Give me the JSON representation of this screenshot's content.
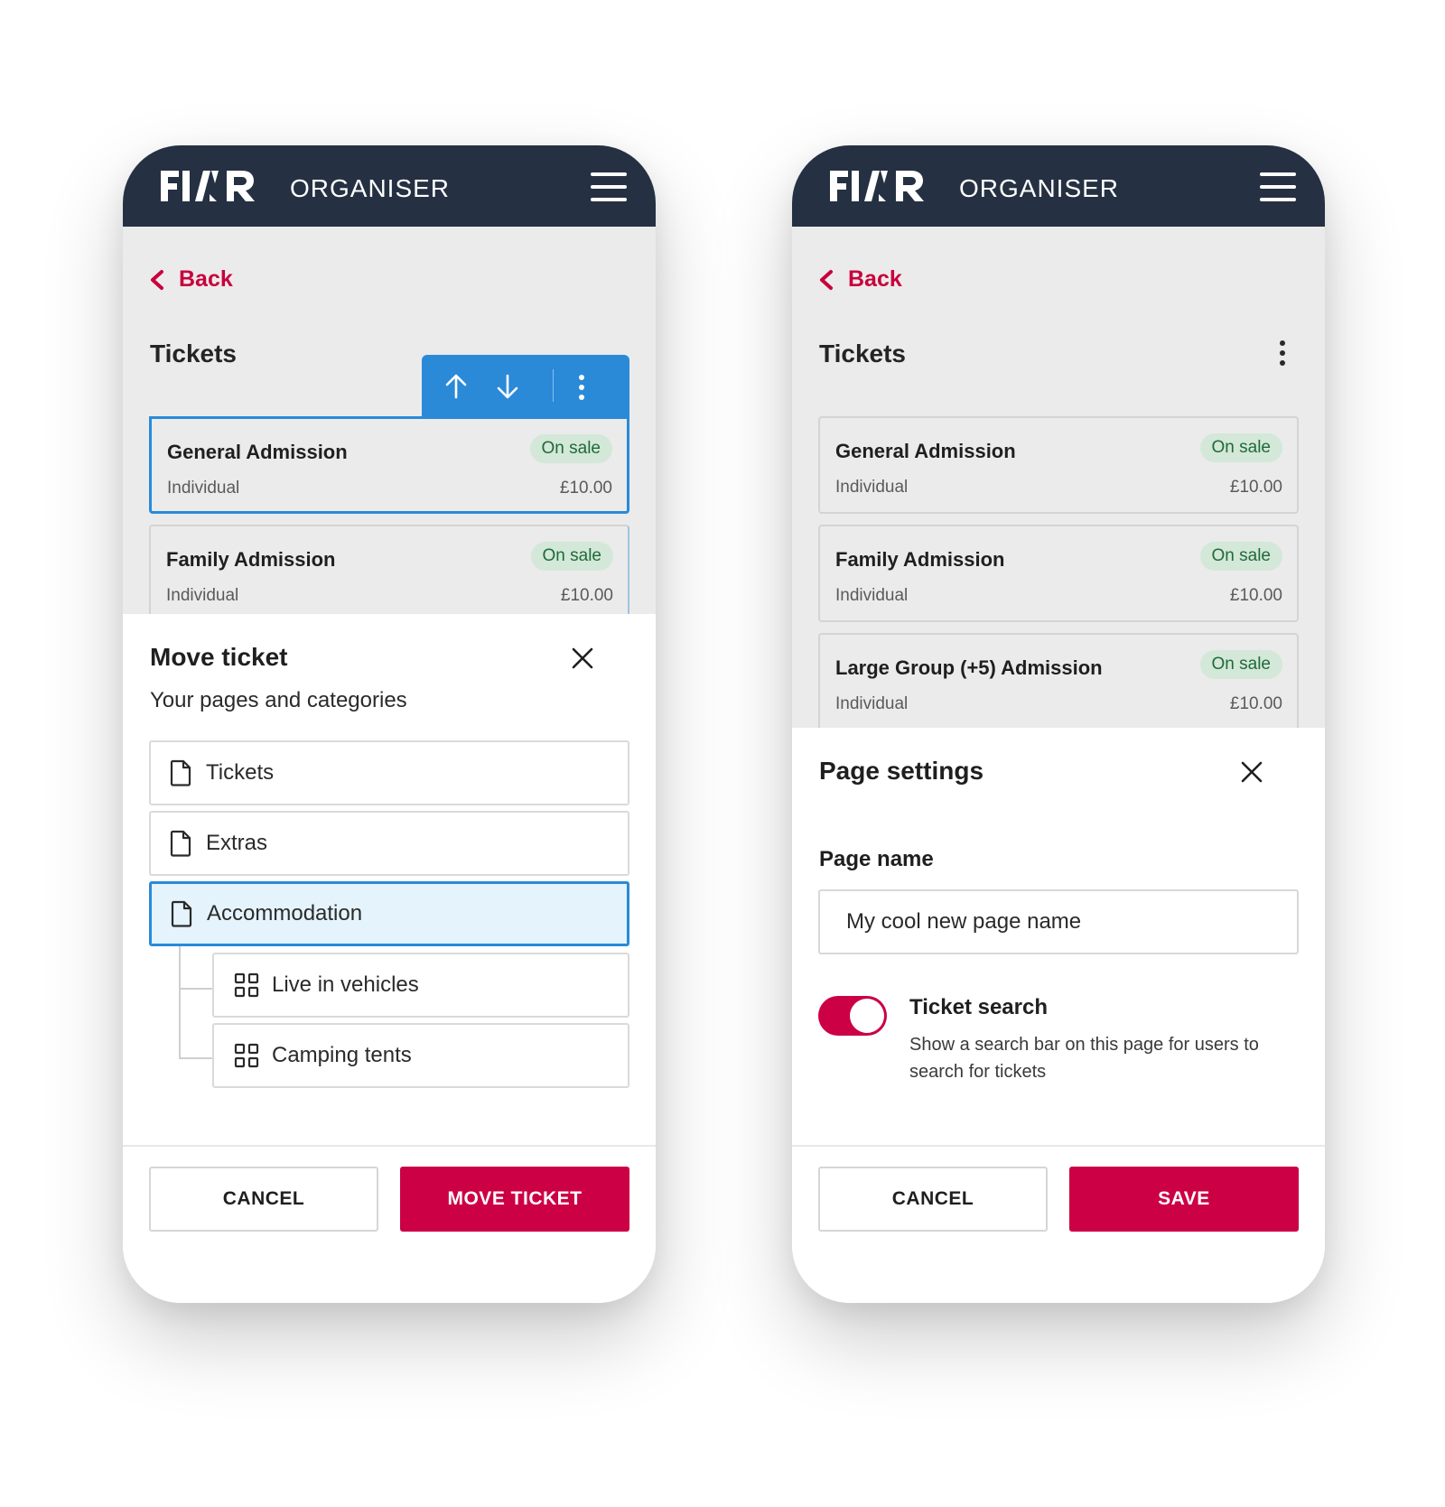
{
  "colors": {
    "navy": "#253142",
    "accent_red": "#cc0044",
    "selection_blue": "#2a8ad8",
    "badge_green_bg": "#d3e8d8",
    "badge_green_text": "#1f6a38"
  },
  "left": {
    "header": {
      "logo": "FIXR",
      "label": "ORGANISER",
      "menu_icon": "hamburger-icon"
    },
    "back_label": "Back",
    "section_title": "Tickets",
    "toolbar": {
      "up_icon": "arrow-up-icon",
      "down_icon": "arrow-down-icon",
      "more_icon": "more-vertical-icon"
    },
    "tickets": [
      {
        "name": "General Admission",
        "status": "On sale",
        "type": "Individual",
        "price": "£10.00"
      },
      {
        "name": "Family Admission",
        "status": "On sale",
        "type": "Individual",
        "price": "£10.00"
      }
    ],
    "sheet": {
      "title": "Move ticket",
      "subtitle": "Your pages and categories",
      "destinations": [
        {
          "label": "Tickets",
          "icon": "page-icon"
        },
        {
          "label": "Extras",
          "icon": "page-icon"
        },
        {
          "label": "Accommodation",
          "icon": "page-icon",
          "selected": true
        }
      ],
      "categories": [
        {
          "label": "Live in vehicles",
          "icon": "grid-icon"
        },
        {
          "label": "Camping tents",
          "icon": "grid-icon"
        }
      ],
      "cancel_label": "CANCEL",
      "confirm_label": "MOVE TICKET"
    }
  },
  "right": {
    "header": {
      "logo": "FIXR",
      "label": "ORGANISER",
      "menu_icon": "hamburger-icon"
    },
    "back_label": "Back",
    "section_title": "Tickets",
    "tickets": [
      {
        "name": "General Admission",
        "status": "On sale",
        "type": "Individual",
        "price": "£10.00"
      },
      {
        "name": "Family Admission",
        "status": "On sale",
        "type": "Individual",
        "price": "£10.00"
      },
      {
        "name": "Large Group (+5) Admission",
        "status": "On sale",
        "type": "Individual",
        "price": "£10.00"
      }
    ],
    "sheet": {
      "title": "Page settings",
      "page_name_label": "Page name",
      "page_name_value": "My cool new page name",
      "ticket_search_enabled": true,
      "ticket_search_title": "Ticket search",
      "ticket_search_desc": "Show a search bar on this page for users to search for tickets",
      "cancel_label": "CANCEL",
      "save_label": "SAVE"
    }
  }
}
